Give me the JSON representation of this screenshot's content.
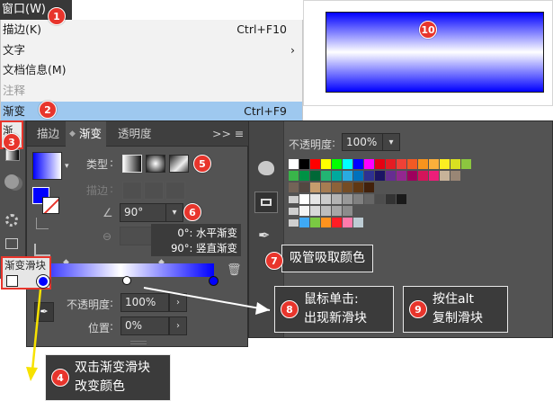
{
  "window_menu": {
    "title": "窗口(W)",
    "items": [
      {
        "label": "描边(K)",
        "shortcut": "Ctrl+F10"
      },
      {
        "label": "文字",
        "shortcut": "›"
      },
      {
        "label": "文档信息(M)",
        "shortcut": ""
      },
      {
        "label": "注释",
        "shortcut": ""
      },
      {
        "label": "渐变",
        "shortcut": "Ctrl+F9"
      }
    ]
  },
  "gradient_panel": {
    "tabs": [
      "描边",
      "渐变",
      "透明度"
    ],
    "menu_glyph": ">>  ≡",
    "type_label": "类型",
    "stroke_label": "描边",
    "angle_value": "90°",
    "hint_line1": "0°: 水平渐变",
    "hint_line2": "90°: 竖直渐变",
    "slider_label": "渐变滑块",
    "opacity_label": "不透明度",
    "opacity_value": "100%",
    "position_label": "位置",
    "position_value": "0%",
    "strip_label": "渐变",
    "colors": {
      "start": "#0000ff",
      "mid": "#ffffff",
      "end": "#0000ff",
      "panel": "#535353"
    }
  },
  "swatch_panel": {
    "opacity_label": "不透明度",
    "opacity_value": "100%",
    "icons": [
      "palette-icon",
      "swatch-grid-icon",
      "eyedropper-icon"
    ]
  },
  "callouts": {
    "c1": "1",
    "c2": "2",
    "c3": "3",
    "c4": "4",
    "c5": "5",
    "c6": "6",
    "c7": "7",
    "c8": "8",
    "c9": "9",
    "c10": "10",
    "note4": [
      "双击渐变滑块",
      "改变颜色"
    ],
    "note7": "吸管吸取颜色",
    "note8": [
      "鼠标单击:",
      "出现新滑块"
    ],
    "note9": [
      "按住alt",
      "复制滑块"
    ]
  }
}
